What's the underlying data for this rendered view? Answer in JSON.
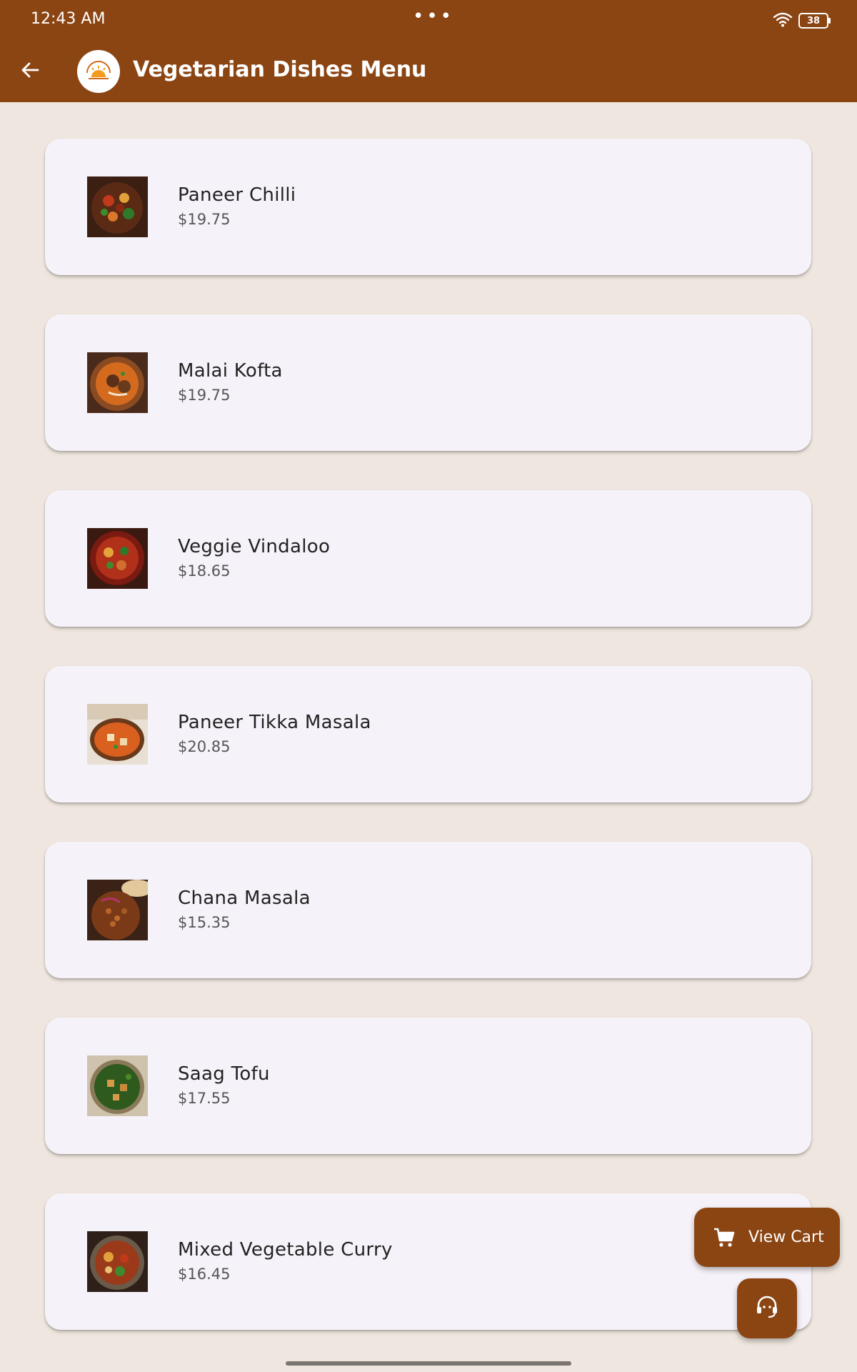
{
  "status_bar": {
    "time": "12:43 AM",
    "dots": "•••",
    "battery": "38",
    "wifi_icon": "wifi-icon"
  },
  "app_bar": {
    "back_icon": "arrow-left-icon",
    "logo_icon": "restaurant-logo",
    "title": "Vegetarian Dishes Menu"
  },
  "colors": {
    "primary": "#8B4513",
    "background": "#EFE7DF",
    "card": "#F6F2F9"
  },
  "menu": {
    "items": [
      {
        "name": "Paneer Chilli",
        "price": "$19.75"
      },
      {
        "name": "Malai Kofta",
        "price": "$19.75"
      },
      {
        "name": "Veggie Vindaloo",
        "price": "$18.65"
      },
      {
        "name": "Paneer Tikka Masala",
        "price": "$20.85"
      },
      {
        "name": "Chana Masala",
        "price": "$15.35"
      },
      {
        "name": "Saag Tofu",
        "price": "$17.55"
      },
      {
        "name": "Mixed Vegetable Curry",
        "price": "$16.45"
      }
    ]
  },
  "fab": {
    "view_cart_label": "View Cart",
    "cart_icon": "shopping-cart-icon",
    "support_icon": "support-agent-icon"
  }
}
